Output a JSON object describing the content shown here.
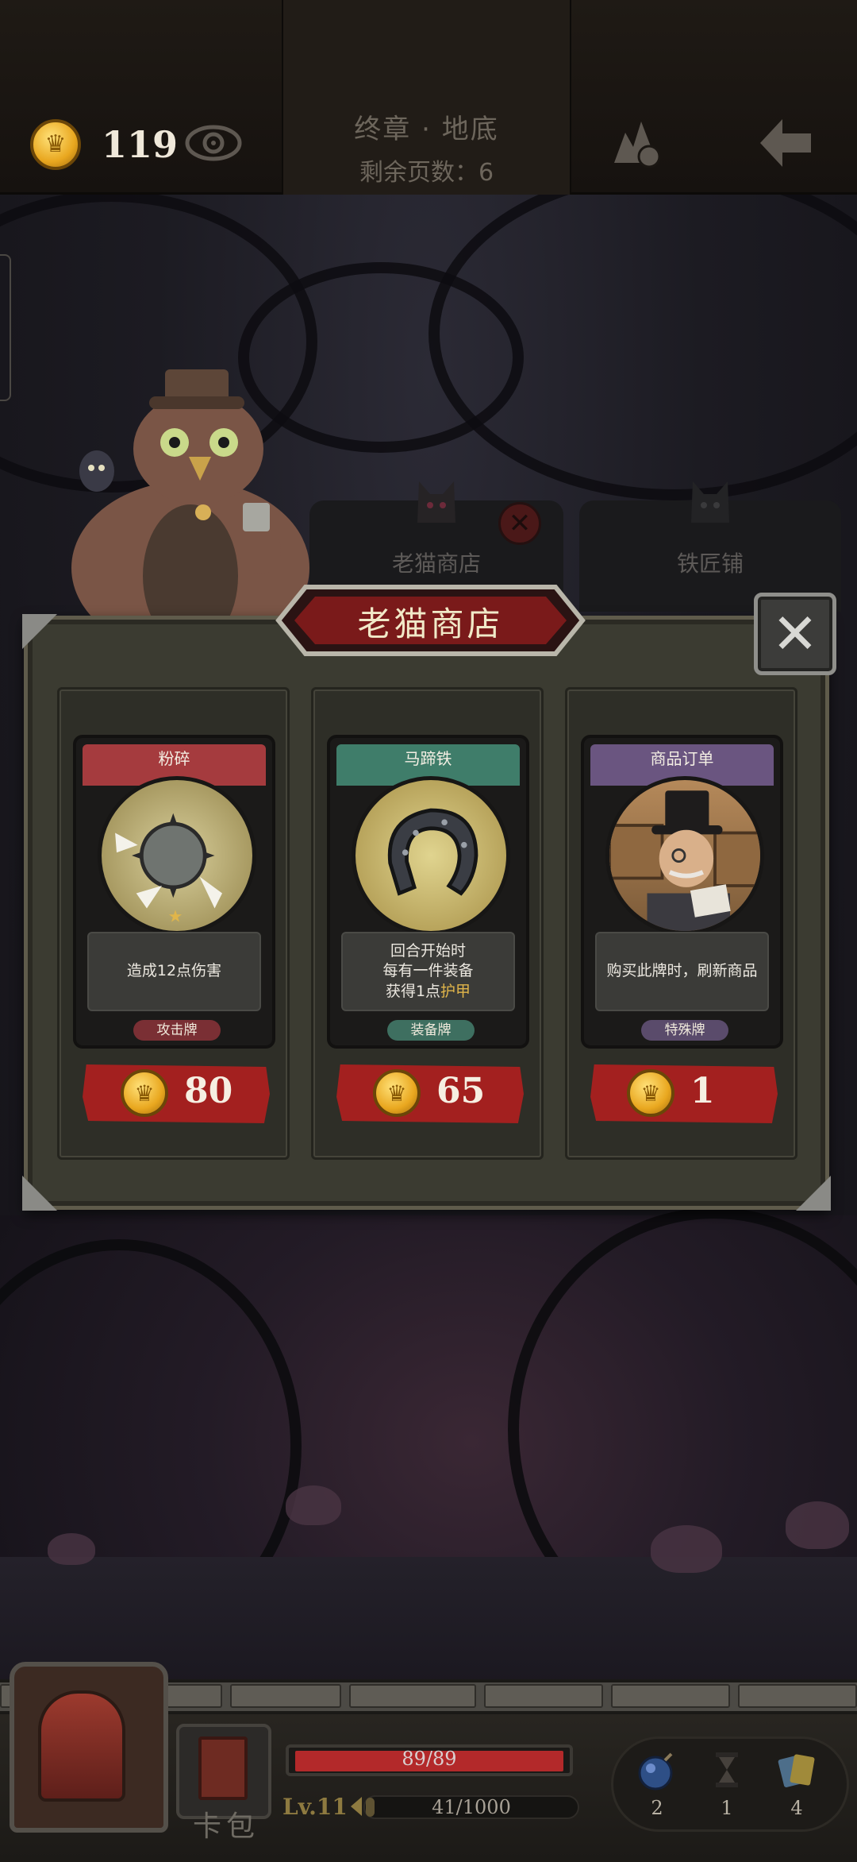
{
  "topbar": {
    "coins": "119",
    "chapter_title": "终章 · 地底",
    "pages_left": "剩余页数：6"
  },
  "tabs": [
    {
      "label": "老猫商店"
    },
    {
      "label": "铁匠铺"
    }
  ],
  "shop": {
    "title": "老猫商店",
    "cards": [
      {
        "name": "粉碎",
        "desc_lines": [
          "造成12点伤害"
        ],
        "type": "攻击牌",
        "price": "80",
        "color": "#a53b3e",
        "tag_color": "#7a2f34",
        "art_icon": "spiked-ball-icon"
      },
      {
        "name": "马蹄铁",
        "desc_lines": [
          "回合开始时",
          "每有一件装备",
          "获得1点"
        ],
        "desc_highlight": "护甲",
        "type": "装备牌",
        "price": "65",
        "color": "#3f7d6a",
        "tag_color": "#3e6f60",
        "art_icon": "horseshoe-icon"
      },
      {
        "name": "商品订单",
        "desc_lines": [
          "购买此牌时，刷新商品"
        ],
        "type": "特殊牌",
        "price": "1",
        "color": "#6a5580",
        "tag_color": "#5a4b6b",
        "art_icon": "merchant-portrait-icon"
      }
    ]
  },
  "hud": {
    "deck_label": "卡包",
    "hp_text": "89/89",
    "hp_fraction": 1.0,
    "level": "Lv.11",
    "xp_text": "41/1000",
    "xp_fraction": 0.041,
    "items": [
      {
        "icon": "bomb-icon",
        "count": "2"
      },
      {
        "icon": "hourglass-icon",
        "count": "1"
      },
      {
        "icon": "cards-icon",
        "count": "4"
      }
    ]
  },
  "colors": {
    "accent_red": "#a3201f",
    "gold": "#e9a71f",
    "panel": "#3b3b31"
  }
}
